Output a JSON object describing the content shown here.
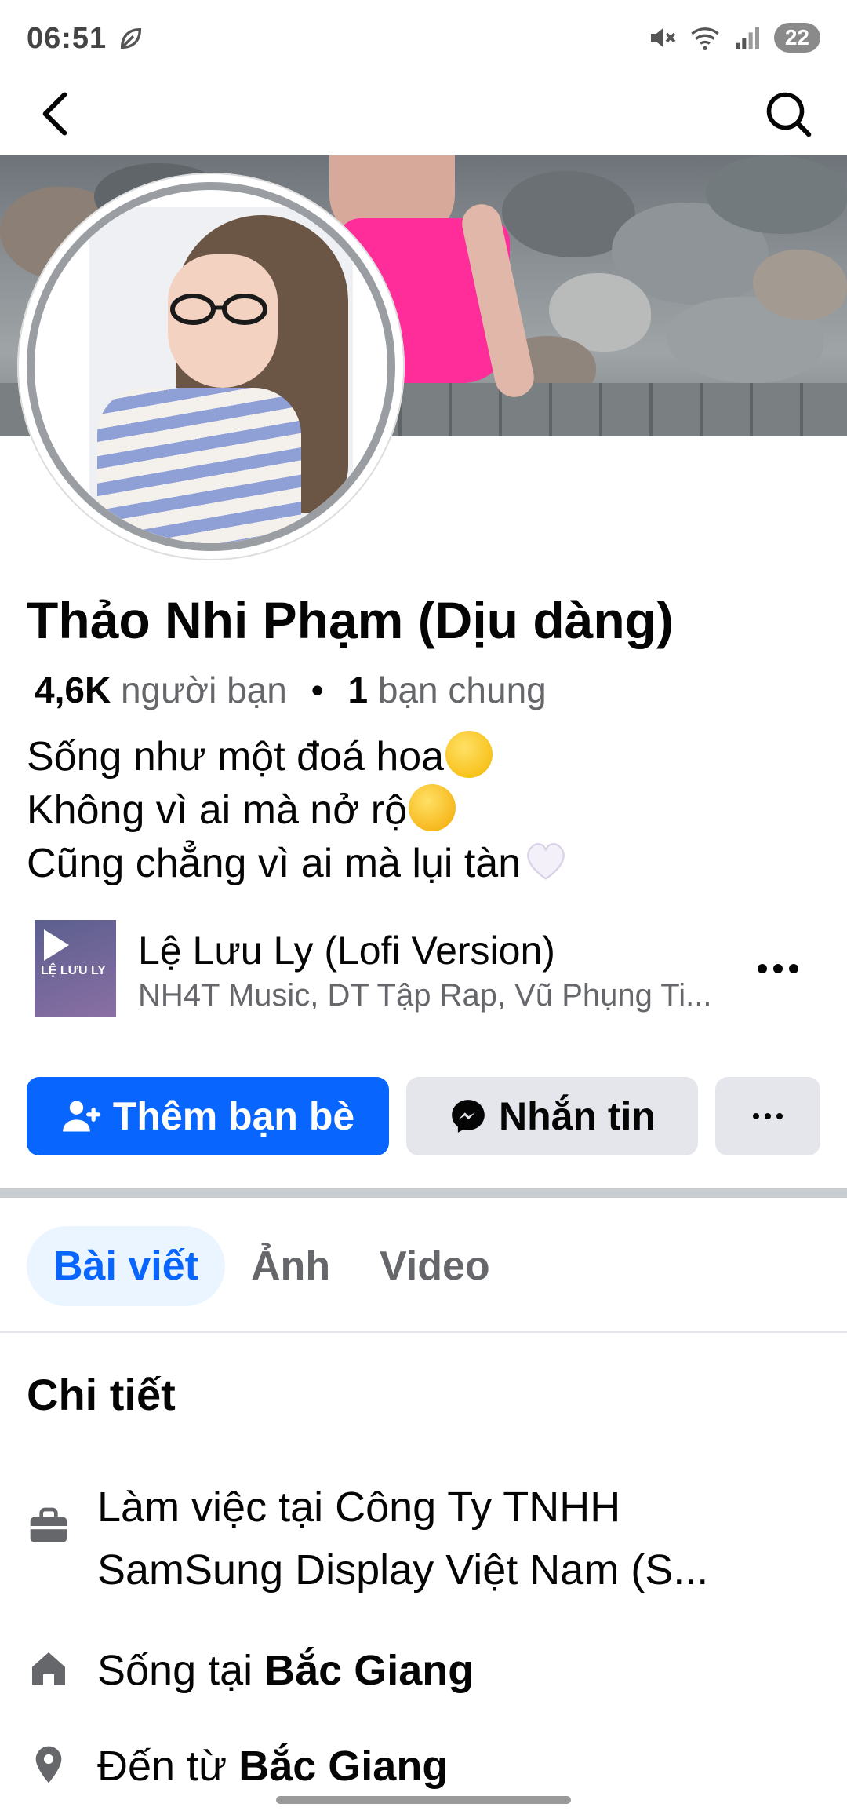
{
  "status_bar": {
    "time": "06:51",
    "battery": "22",
    "icons": [
      "leaf-icon",
      "mute-icon",
      "wifi-icon",
      "signal-icon"
    ]
  },
  "nav": {
    "back_icon": "chevron-left-icon",
    "search_icon": "search-icon"
  },
  "profile": {
    "name": "Thảo Nhi Phạm (Dịu dàng)",
    "friends_count": "4,6K",
    "friends_label": "người bạn",
    "separator": "•",
    "mutual_count": "1",
    "mutual_label": "bạn chung",
    "bio_lines": [
      "Sống như một đoá hoa",
      "Không vì ai mà nở rộ",
      "Cũng chẳng vì ai mà lụi tàn"
    ],
    "bio_emojis": [
      "slightly-smiling-emoji",
      "smiling-blush-emoji",
      "white-heart-emoji"
    ]
  },
  "music": {
    "cover_text": "LỆ LƯU LY",
    "title": "Lệ Lưu Ly (Lofi Version)",
    "artist": "NH4T Music, DT Tập Rap, Vũ Phụng Ti..."
  },
  "actions": {
    "add_friend": "Thêm bạn bè",
    "message": "Nhắn tin",
    "more_icon": "ellipsis-icon"
  },
  "tabs": [
    {
      "label": "Bài viết",
      "active": true
    },
    {
      "label": "Ảnh",
      "active": false
    },
    {
      "label": "Video",
      "active": false
    }
  ],
  "details": {
    "title": "Chi tiết",
    "work_line1": "Làm việc tại Công Ty TNHH",
    "work_line2": "SamSung Display Việt Nam (S...",
    "lives_prefix": "Sống tại ",
    "lives_place": "Bắc Giang",
    "from_prefix": "Đến từ ",
    "from_place": "Bắc Giang"
  },
  "colors": {
    "primary": "#0866ff",
    "secondary_button": "#e4e6eb",
    "muted_text": "#65676b"
  }
}
